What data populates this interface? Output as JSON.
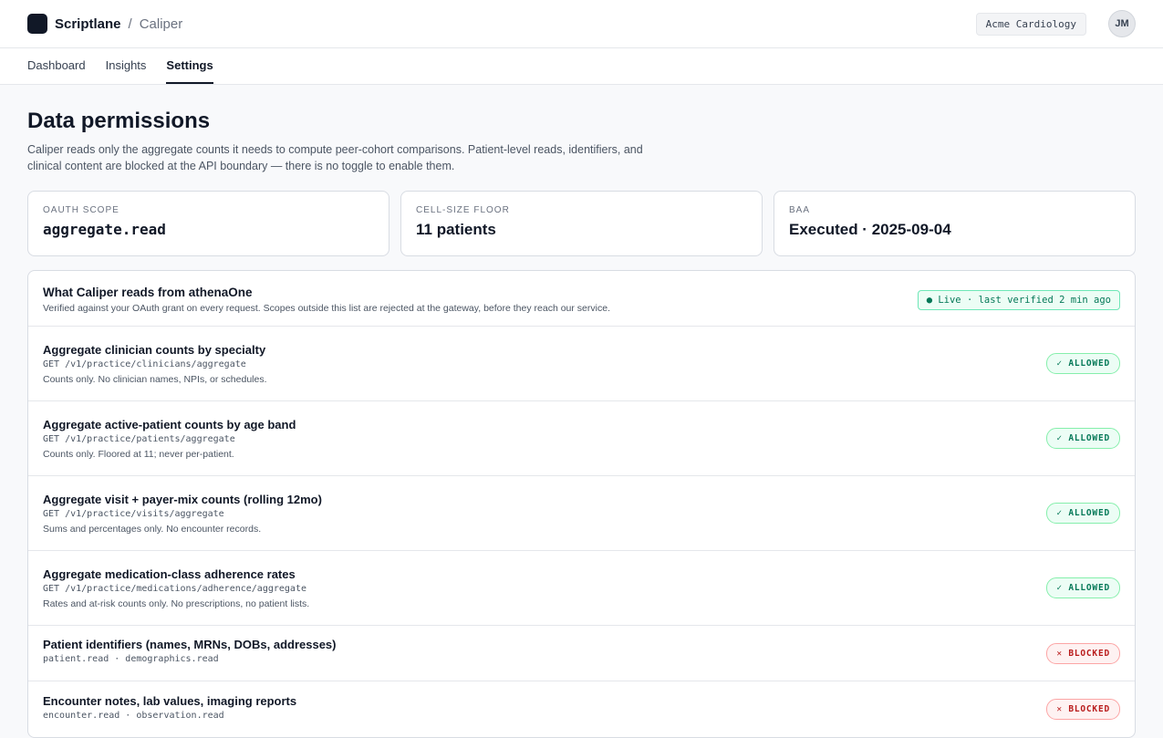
{
  "header": {
    "brand": "Scriptlane",
    "separator": "/",
    "product": "Caliper",
    "org": "Acme Cardiology",
    "avatar_initials": "JM"
  },
  "tabs": [
    {
      "label": "Dashboard",
      "active": false
    },
    {
      "label": "Insights",
      "active": false
    },
    {
      "label": "Settings",
      "active": true
    }
  ],
  "page": {
    "title": "Data permissions",
    "description": "Caliper reads only the aggregate counts it needs to compute peer-cohort comparisons. Patient-level reads, identifiers, and clinical content are blocked at the API boundary — there is no toggle to enable them."
  },
  "stats": [
    {
      "label": "OAUTH SCOPE",
      "value": "aggregate.read"
    },
    {
      "label": "CELL-SIZE FLOOR",
      "value": "11 patients"
    },
    {
      "label": "BAA",
      "value": "Executed · 2025-09-04"
    }
  ],
  "panel": {
    "title": "What Caliper reads from athenaOne",
    "subtitle": "Verified against your OAuth grant on every request. Scopes outside this list are rejected at the gateway, before they reach our service.",
    "live_badge": "● Live · last verified 2 min ago",
    "rows": [
      {
        "title": "Aggregate clinician counts by specialty",
        "endpoint": "GET /v1/practice/clinicians/aggregate",
        "note": "Counts only. No clinician names, NPIs, or schedules.",
        "status": "allowed",
        "badge": "✓ ALLOWED"
      },
      {
        "title": "Aggregate active-patient counts by age band",
        "endpoint": "GET /v1/practice/patients/aggregate",
        "note": "Counts only. Floored at 11; never per-patient.",
        "status": "allowed",
        "badge": "✓ ALLOWED"
      },
      {
        "title": "Aggregate visit + payer-mix counts (rolling 12mo)",
        "endpoint": "GET /v1/practice/visits/aggregate",
        "note": "Sums and percentages only. No encounter records.",
        "status": "allowed",
        "badge": "✓ ALLOWED"
      },
      {
        "title": "Aggregate medication-class adherence rates",
        "endpoint": "GET /v1/practice/medications/adherence/aggregate",
        "note": "Rates and at-risk counts only. No prescriptions, no patient lists.",
        "status": "allowed",
        "badge": "✓ ALLOWED"
      },
      {
        "title": "Patient identifiers (names, MRNs, DOBs, addresses)",
        "endpoint": "patient.read · demographics.read",
        "note": "",
        "status": "blocked",
        "badge": "✕ BLOCKED"
      },
      {
        "title": "Encounter notes, lab values, imaging reports",
        "endpoint": "encounter.read · observation.read",
        "note": "",
        "status": "blocked",
        "badge": "✕ BLOCKED"
      }
    ]
  }
}
